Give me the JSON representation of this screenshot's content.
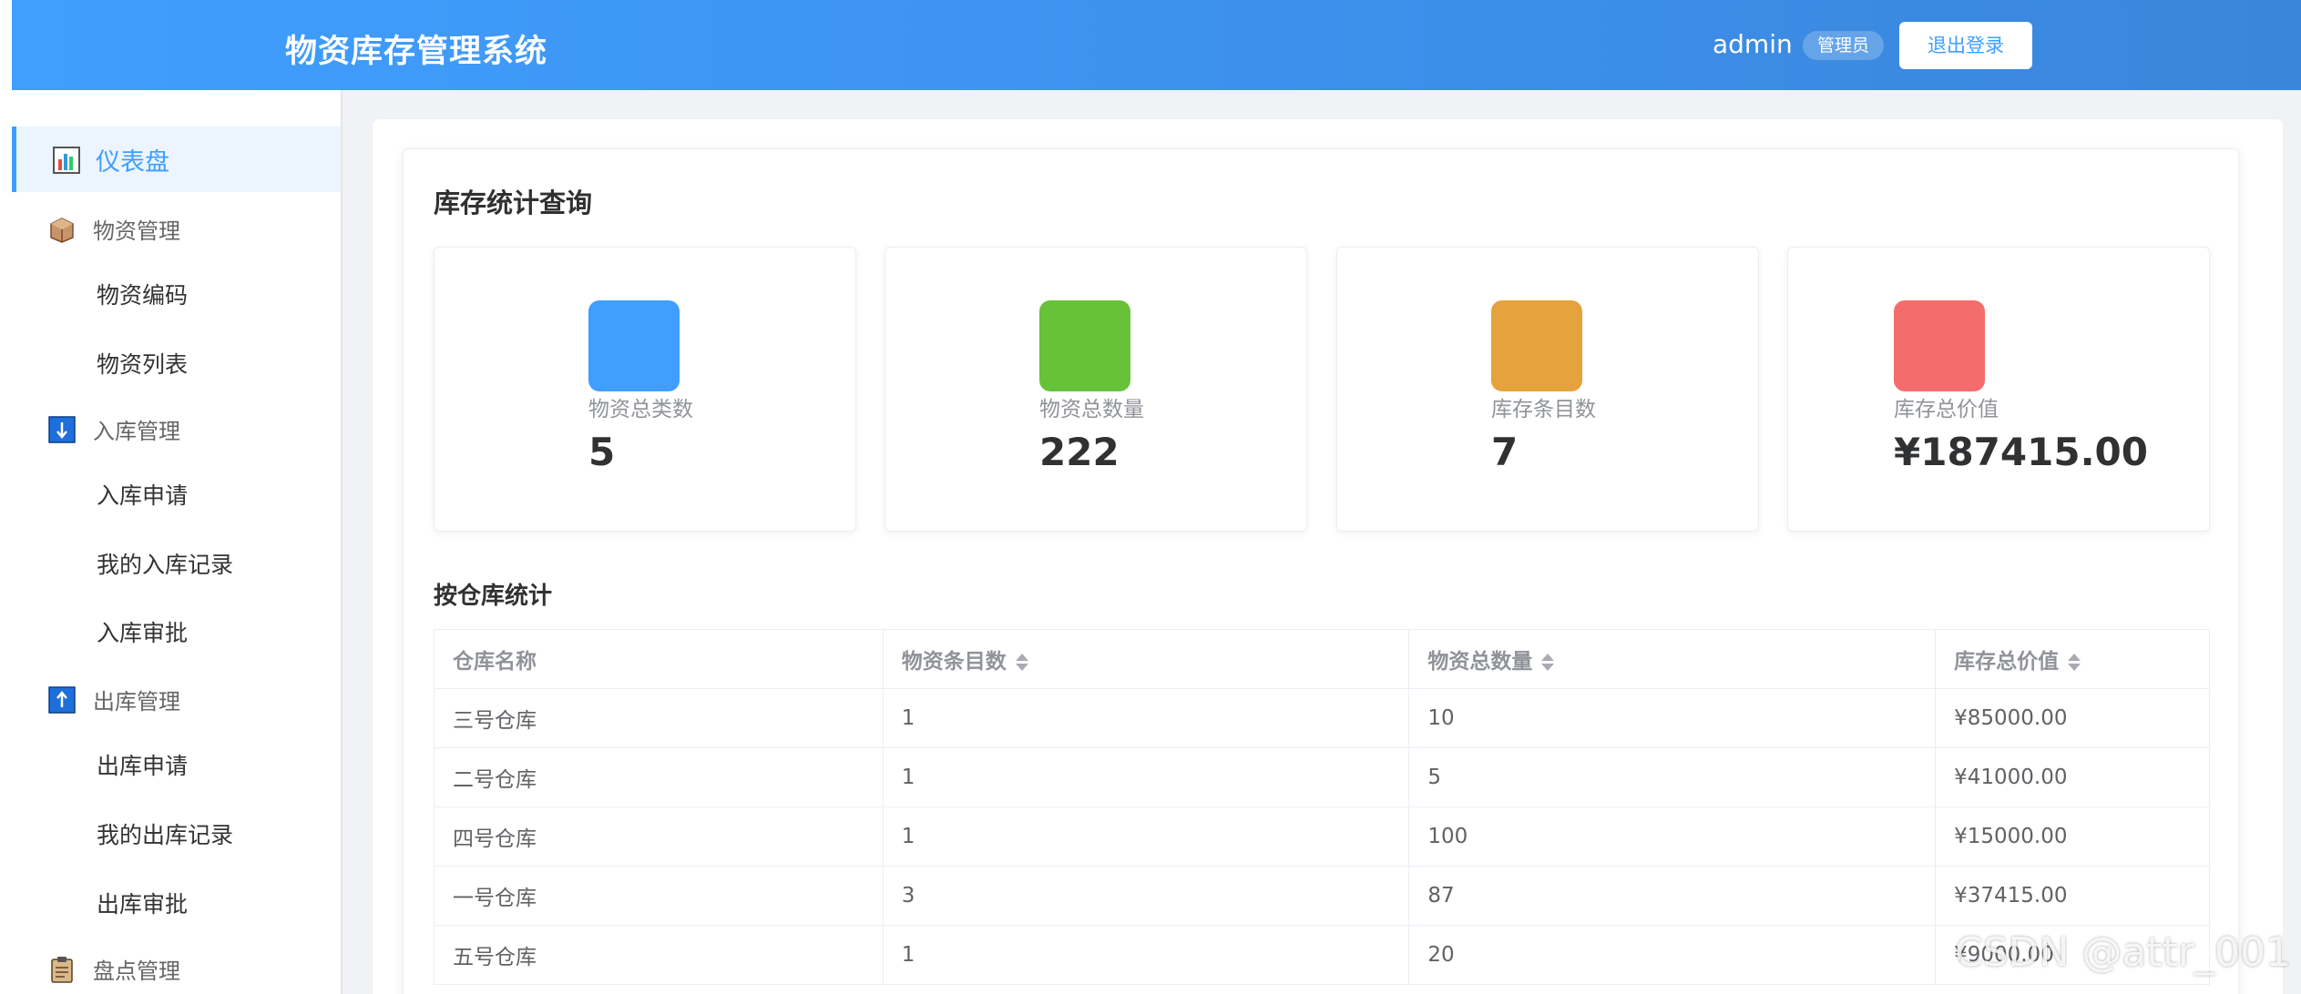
{
  "header": {
    "title": "物资库存管理系统",
    "user": "admin",
    "role": "管理员",
    "logout_label": "退出登录",
    "accent": "#409eff"
  },
  "sidebar": {
    "items": [
      {
        "label": "仪表盘",
        "icon": "bar-chart-icon",
        "type": "active"
      },
      {
        "label": "物资管理",
        "icon": "box-icon",
        "type": "group"
      },
      {
        "label": "物资编码",
        "type": "sub"
      },
      {
        "label": "物资列表",
        "type": "sub"
      },
      {
        "label": "入库管理",
        "icon": "down-arrow-icon",
        "type": "group"
      },
      {
        "label": "入库申请",
        "type": "sub"
      },
      {
        "label": "我的入库记录",
        "type": "sub"
      },
      {
        "label": "入库审批",
        "type": "sub"
      },
      {
        "label": "出库管理",
        "icon": "up-arrow-icon",
        "type": "group"
      },
      {
        "label": "出库申请",
        "type": "sub"
      },
      {
        "label": "我的出库记录",
        "type": "sub"
      },
      {
        "label": "出库审批",
        "type": "sub"
      },
      {
        "label": "盘点管理",
        "icon": "clipboard-icon",
        "type": "group"
      }
    ]
  },
  "main": {
    "heading": "库存统计查询",
    "stats": [
      {
        "label": "物资总类数",
        "value": "5",
        "color": "#409eff"
      },
      {
        "label": "物资总数量",
        "value": "222",
        "color": "#67c23a"
      },
      {
        "label": "库存条目数",
        "value": "7",
        "color": "#e6a23c"
      },
      {
        "label": "库存总价值",
        "value": "¥187415.00",
        "color": "#f56c6c"
      }
    ],
    "table_heading": "按仓库统计",
    "table": {
      "columns": [
        "仓库名称",
        "物资条目数",
        "物资总数量",
        "库存总价值"
      ],
      "rows": [
        [
          "三号仓库",
          "1",
          "10",
          "¥85000.00"
        ],
        [
          "二号仓库",
          "1",
          "5",
          "¥41000.00"
        ],
        [
          "四号仓库",
          "1",
          "100",
          "¥15000.00"
        ],
        [
          "一号仓库",
          "3",
          "87",
          "¥37415.00"
        ],
        [
          "五号仓库",
          "1",
          "20",
          "¥9000.00"
        ]
      ]
    }
  },
  "watermark": "CSDN @attr_001"
}
